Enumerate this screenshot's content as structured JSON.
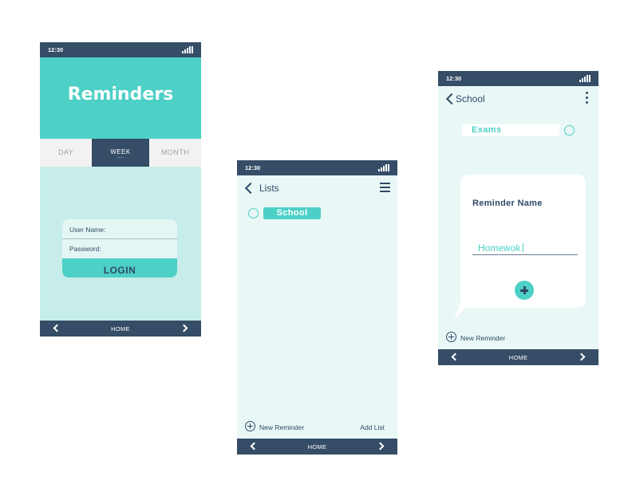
{
  "colors": {
    "navy": "#354d66",
    "teal": "#4dd0c6",
    "mint_bg": "#c6ede9",
    "light_bg": "#e9f8f6",
    "text": "#2f4a66"
  },
  "login_screen": {
    "status_time": "12:30",
    "title": "Reminders",
    "tabs": [
      {
        "label": "DAY",
        "dots": "...."
      },
      {
        "label": "WEEK",
        "dots": "....",
        "selected": true
      },
      {
        "label": "MONTH",
        "dots": "...."
      }
    ],
    "username_label": "User Name:",
    "password_label": "Password:",
    "login_button": "LOGIN",
    "bottom_nav": {
      "home_label": "HOME",
      "left_icon": "chevron-left-icon",
      "right_icon": "chevron-right-icon"
    }
  },
  "lists_screen": {
    "status_time": "12:30",
    "header_title": "Lists",
    "menu_icon": "hamburger-icon",
    "lists": [
      {
        "label": "School"
      }
    ],
    "new_reminder_label": "New Reminder",
    "add_list_label": "Add List",
    "bottom_nav": {
      "home_label": "HOME"
    }
  },
  "school_screen": {
    "status_time": "12:30",
    "header_title": "School",
    "menu_icon": "more-vertical-icon",
    "items": [
      {
        "label": "Exams"
      }
    ],
    "card": {
      "title": "Reminder Name",
      "input_value": "Homewok"
    },
    "new_reminder_label": "New Reminder",
    "bottom_nav": {
      "home_label": "HOME"
    }
  }
}
